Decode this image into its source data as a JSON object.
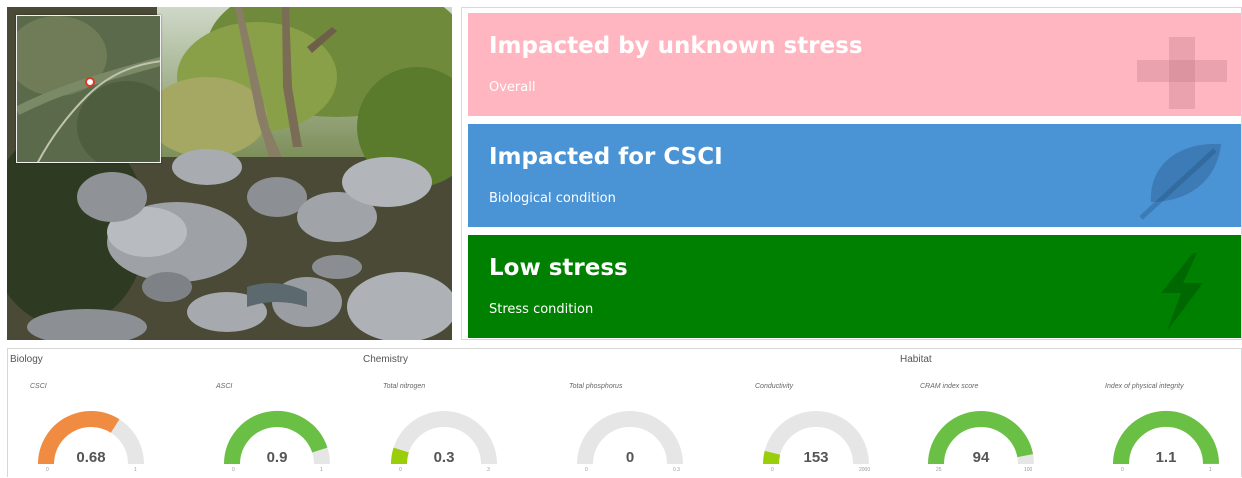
{
  "status_cards": [
    {
      "title": "Impacted by unknown stress",
      "subtitle": "Overall",
      "icon": "plus-icon",
      "color": "#ffb6c1"
    },
    {
      "title": "Impacted for CSCI",
      "subtitle": "Biological condition",
      "icon": "leaf-icon",
      "color": "#4a93d4"
    },
    {
      "title": "Low stress",
      "subtitle": "Stress condition",
      "icon": "lightning-icon",
      "color": "#008000"
    }
  ],
  "sections": {
    "biology": "Biology",
    "chemistry": "Chemistry",
    "habitat": "Habitat"
  },
  "gauges": [
    {
      "label": "CSCI",
      "value": "0.68",
      "fraction": 0.68,
      "min": "0",
      "max": "1",
      "color": "#f08c42"
    },
    {
      "label": "ASCI",
      "value": "0.9",
      "fraction": 0.9,
      "min": "0",
      "max": "1",
      "color": "#6abf45"
    },
    {
      "label": "Total nitrogen",
      "value": "0.3",
      "fraction": 0.1,
      "min": "0",
      "max": "3",
      "color": "#9acd0a"
    },
    {
      "label": "Total phosphorus",
      "value": "0",
      "fraction": 0.0,
      "min": "0",
      "max": "0.3",
      "color": "#9acd0a"
    },
    {
      "label": "Conductivity",
      "value": "153",
      "fraction": 0.08,
      "min": "0",
      "max": "2000",
      "color": "#9acd0a"
    },
    {
      "label": "CRAM index score",
      "value": "94",
      "fraction": 0.94,
      "min": "25",
      "max": "100",
      "color": "#6abf45"
    },
    {
      "label": "Index of physical integrity",
      "value": "1.1",
      "fraction": 1.0,
      "min": "0",
      "max": "1",
      "color": "#6abf45"
    }
  ],
  "colors": {
    "gauge_track": "#e6e6e6"
  }
}
